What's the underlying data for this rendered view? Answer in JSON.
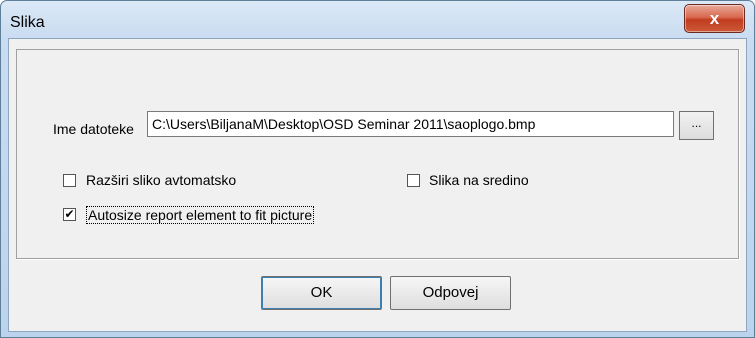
{
  "window": {
    "title": "Slika",
    "close_glyph": "x"
  },
  "form": {
    "filename_label": "Ime datoteke",
    "filename_value": "C:\\Users\\BiljanaM\\Desktop\\OSD Seminar 2011\\saoplogo.bmp",
    "browse_label": "...",
    "stretch_label": "Razširi sliko avtomatsko",
    "stretch_checked": false,
    "center_label": "Slika na sredino",
    "center_checked": false,
    "autosize_label": "Autosize report element to fit picture",
    "autosize_checked": true,
    "check_glyph": "✔"
  },
  "buttons": {
    "ok": "OK",
    "cancel": "Odpovej"
  }
}
